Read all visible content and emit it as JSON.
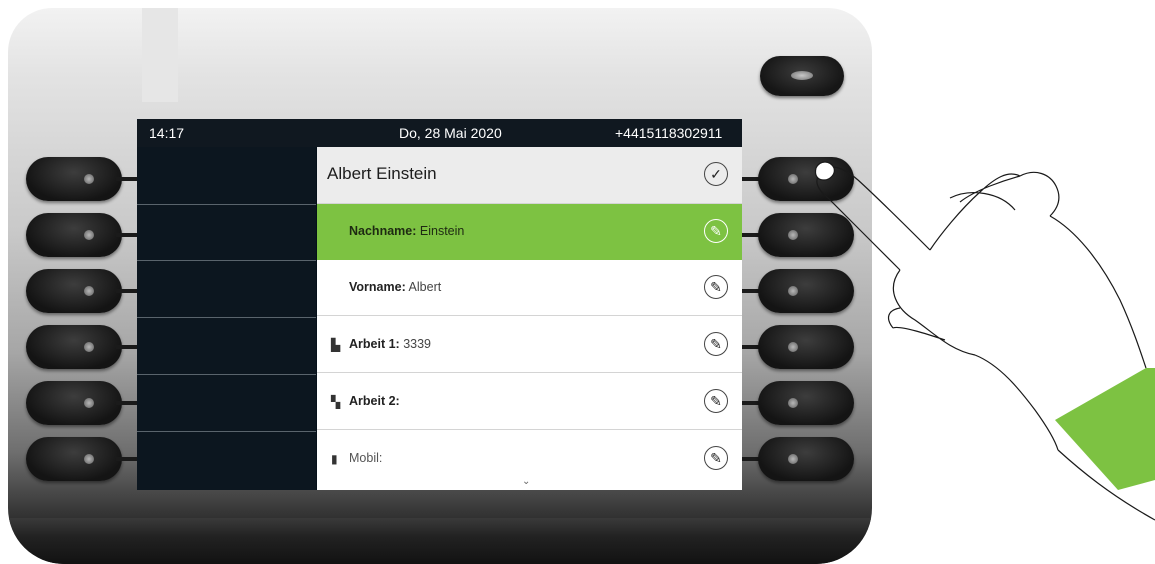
{
  "status_bar": {
    "time": "14:17",
    "date": "Do, 28 Mai 2020",
    "number": "+4415118302911"
  },
  "contact": {
    "name": "Albert Einstein",
    "confirm_icon": "checkmark-icon",
    "fields": [
      {
        "label": "Nachname",
        "value": "Einstein",
        "icon": "pencil-icon",
        "selected": true
      },
      {
        "label": "Vorname",
        "value": "Albert",
        "icon": "pencil-icon",
        "selected": false
      },
      {
        "label": "Arbeit 1",
        "value": "3339",
        "icon": "pencil-icon",
        "left_icon": "building-icon",
        "selected": false
      },
      {
        "label": "Arbeit 2",
        "value": "",
        "icon": "pencil-icon",
        "left_icon": "building-2-icon",
        "selected": false
      },
      {
        "label": "Mobil",
        "value": "",
        "icon": "pencil-icon",
        "left_icon": "mobile-phone-icon",
        "selected": false
      }
    ]
  },
  "colors": {
    "accent": "#7dc242",
    "screen_bg": "#0c161f"
  },
  "decor": {
    "scroll_icon": "chevron-down-icon",
    "hand_icon": "pointing-hand-icon"
  }
}
